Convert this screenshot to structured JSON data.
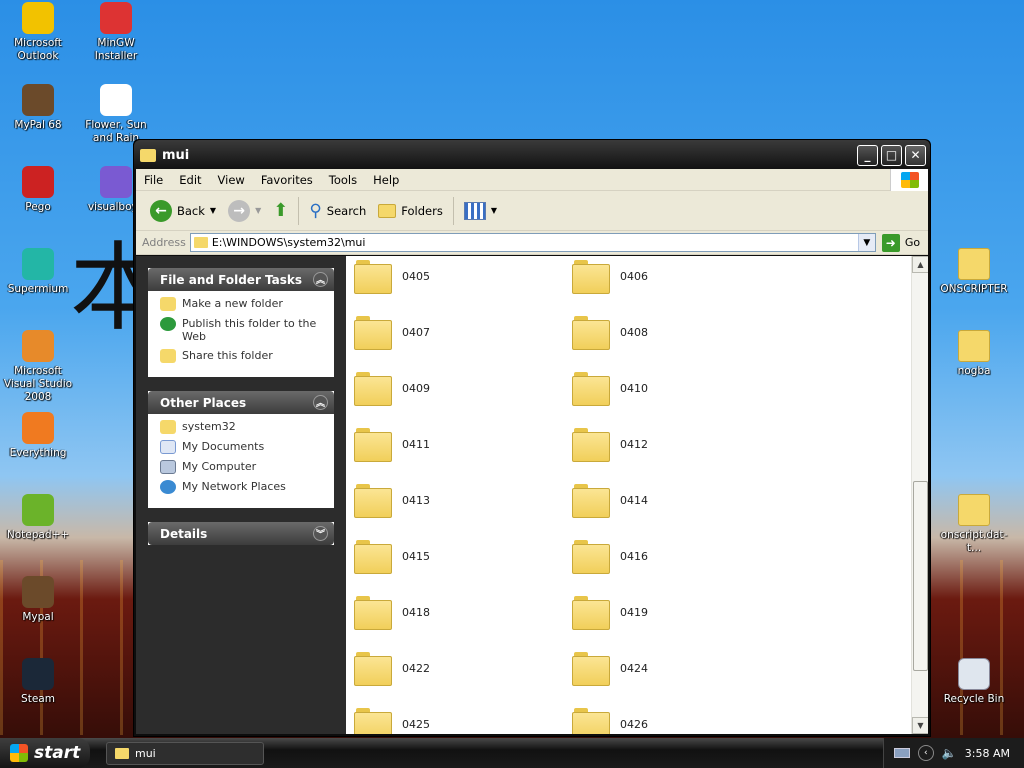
{
  "desktop": {
    "left_icons": [
      {
        "label": "Microsoft Outlook",
        "icon": "outlook-icon",
        "color": "#f2c200"
      },
      {
        "label": "MinGW Installer",
        "icon": "installer-icon",
        "color": "#d33"
      },
      {
        "label": "MyPal 68",
        "icon": "mypal-icon",
        "color": "#6b4a2a"
      },
      {
        "label": "Flower, Sun and Rain",
        "icon": "document-icon",
        "color": "#ffffff"
      },
      {
        "label": "Pego",
        "icon": "pego-icon",
        "color": "#c22"
      },
      {
        "label": "visualboya",
        "icon": "gamepad-icon",
        "color": "#7a5ad2"
      },
      {
        "label": "Supermium",
        "icon": "supermium-icon",
        "color": "#23b6a6"
      },
      {
        "label": "Microsoft Visual Studio 2008",
        "icon": "visual-studio-icon",
        "color": "#e78a2a"
      },
      {
        "label": "Everything",
        "icon": "everything-icon",
        "color": "#f07a20"
      },
      {
        "label": "Notepad++",
        "icon": "notepad-plus-icon",
        "color": "#6bb32a"
      },
      {
        "label": "Mypal",
        "icon": "mypal-icon",
        "color": "#6b4a2a"
      },
      {
        "label": "Steam",
        "icon": "steam-icon",
        "color": "#1b2838"
      }
    ],
    "right_icons": [
      {
        "label": "ONSCRIPTER",
        "icon": "folder-icon"
      },
      {
        "label": "nogba",
        "icon": "folder-icon"
      },
      {
        "label": "onscript.dat-t...",
        "icon": "folder-icon"
      },
      {
        "label": "Recycle Bin",
        "icon": "recycle-bin-icon"
      }
    ]
  },
  "window": {
    "title": "mui",
    "menu": [
      "File",
      "Edit",
      "View",
      "Favorites",
      "Tools",
      "Help"
    ],
    "toolbar": {
      "back": "Back",
      "search": "Search",
      "folders": "Folders"
    },
    "address": {
      "label": "Address",
      "value": "E:\\WINDOWS\\system32\\mui",
      "go": "Go"
    },
    "tasks": {
      "title": "File and Folder Tasks",
      "items": [
        "Make a new folder",
        "Publish this folder to the Web",
        "Share this folder"
      ]
    },
    "places": {
      "title": "Other Places",
      "items": [
        "system32",
        "My Documents",
        "My Computer",
        "My Network Places"
      ]
    },
    "details": {
      "title": "Details"
    },
    "folders": [
      "0405",
      "0406",
      "0407",
      "0408",
      "0409",
      "0410",
      "0411",
      "0412",
      "0413",
      "0414",
      "0415",
      "0416",
      "0418",
      "0419",
      "0422",
      "0424",
      "0425",
      "0426"
    ]
  },
  "taskbar": {
    "start": "start",
    "task": "mui",
    "clock": "3:58 AM"
  }
}
